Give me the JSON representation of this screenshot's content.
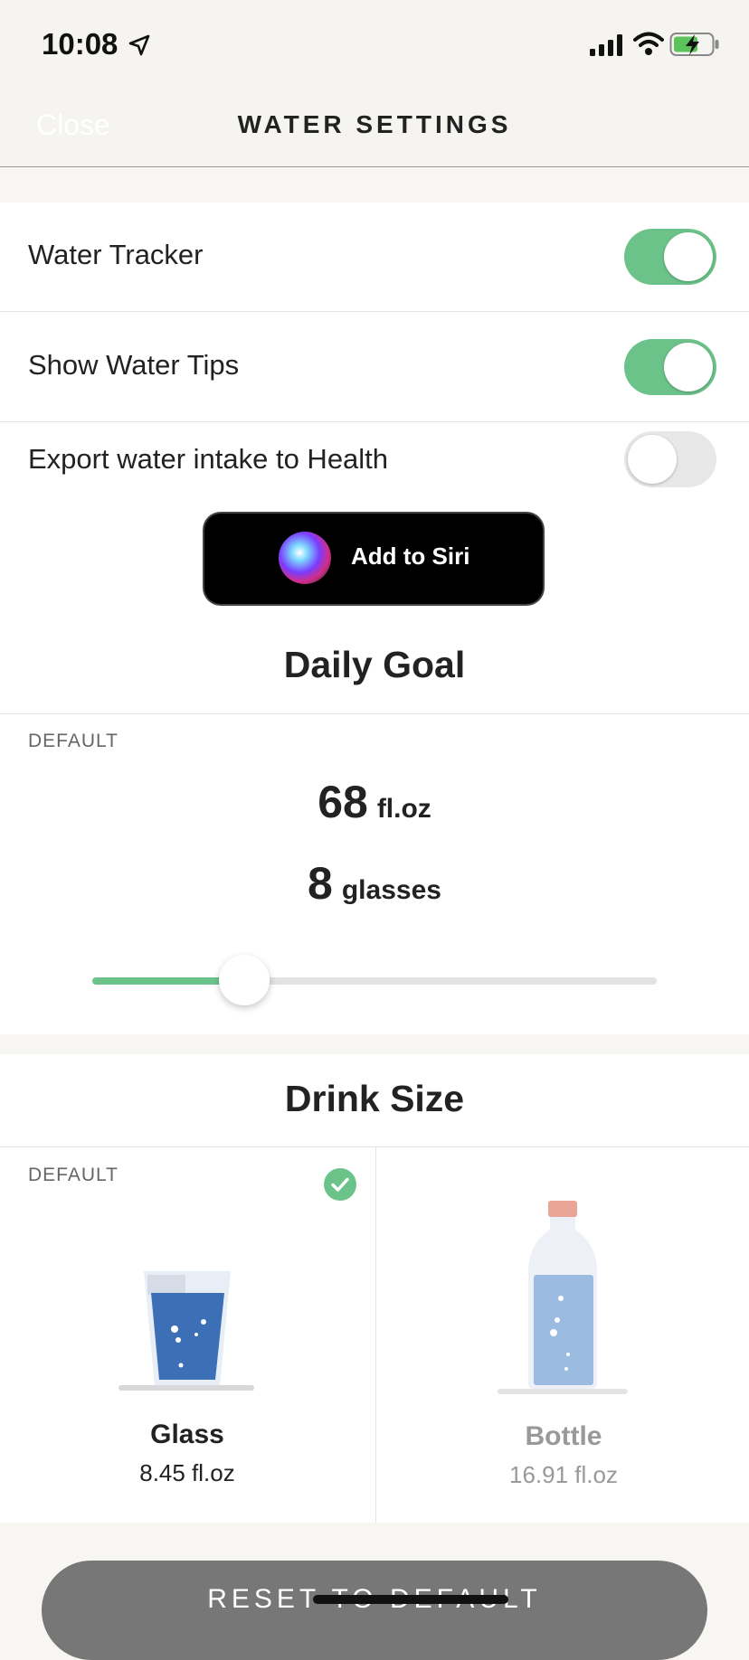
{
  "status_bar": {
    "time": "10:08",
    "icons": [
      "location-arrow-icon",
      "cellular-signal-icon",
      "wifi-icon",
      "battery-charging-icon"
    ]
  },
  "nav": {
    "close_label": "Close",
    "title": "WATER SETTINGS"
  },
  "settings": {
    "rows": [
      {
        "label": "Water Tracker",
        "toggle_on": true
      },
      {
        "label": "Show Water Tips",
        "toggle_on": true
      },
      {
        "label": "Export water intake to Health",
        "toggle_on": false
      }
    ]
  },
  "siri": {
    "label": "Add to Siri"
  },
  "daily_goal": {
    "title": "Daily Goal",
    "default_label": "DEFAULT",
    "amount": "68",
    "amount_unit": "fl.oz",
    "glasses": "8",
    "glasses_unit": "glasses",
    "slider_fraction": 0.27
  },
  "drink_size": {
    "title": "Drink Size",
    "default_label": "DEFAULT",
    "options": [
      {
        "name": "Glass",
        "size": "8.45 fl.oz",
        "selected": true
      },
      {
        "name": "Bottle",
        "size": "16.91 fl.oz",
        "selected": false
      }
    ]
  },
  "reset": {
    "label": "RESET TO DEFAULT"
  },
  "colors": {
    "accent_green": "#6cc38a",
    "glass_water": "#3d6fb6",
    "bottle_water": "#9bbce0"
  }
}
